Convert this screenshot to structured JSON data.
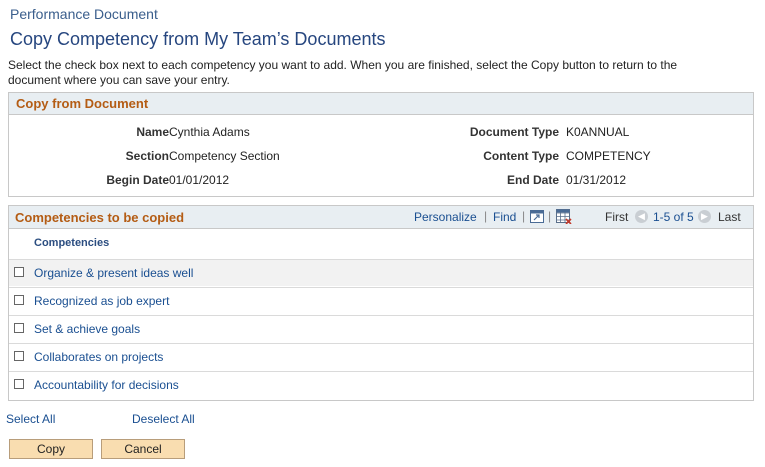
{
  "breadcrumb": "Performance Document",
  "title": "Copy Competency from My Team’s Documents",
  "instructions": "Select the check box next to each competency you want to add. When you are finished, select the Copy button to return to the document where you can save your entry.",
  "copy_from": {
    "title": "Copy from Document",
    "name_label": "Name",
    "name": "Cynthia Adams",
    "section_label": "Section",
    "section": "Competency Section",
    "begin_label": "Begin Date",
    "begin": "01/01/2012",
    "doctype_label": "Document Type",
    "doctype": "K0ANNUAL",
    "content_label": "Content Type",
    "content": "COMPETENCY",
    "end_label": "End Date",
    "end": "01/31/2012"
  },
  "grid": {
    "title": "Competencies to be copied",
    "personalize": "Personalize",
    "find": "Find",
    "first": "First",
    "range": "1-5 of 5",
    "last": "Last",
    "column": "Competencies",
    "rows": [
      "Organize & present ideas well",
      "Recognized as job expert",
      "Set & achieve goals",
      "Collaborates on projects",
      "Accountability for decisions"
    ]
  },
  "select_all": "Select All",
  "deselect_all": "Deselect All",
  "copy_button": "Copy",
  "cancel_button": "Cancel",
  "icons": {
    "prev": "arrow-left-icon",
    "next": "arrow-right-icon",
    "view_all": "new-window-icon",
    "download": "spreadsheet-icon"
  }
}
